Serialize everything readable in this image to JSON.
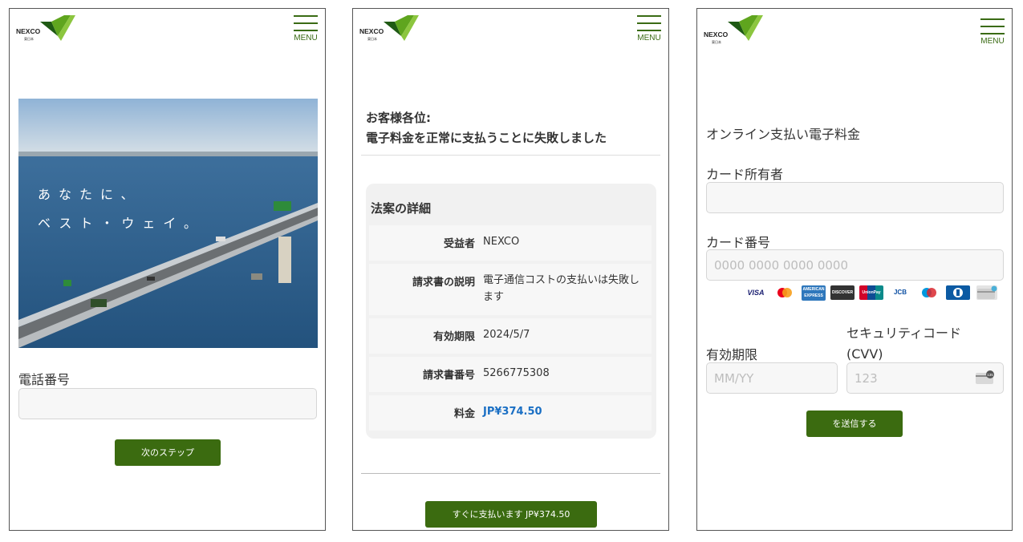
{
  "panels": [
    {
      "logo_text": "NEXCO",
      "logo_sub": "東日本",
      "menu_label": "MENU"
    },
    {
      "logo_text": "NEXCO",
      "logo_sub": "東日本",
      "menu_label": "MENU"
    },
    {
      "logo_text": "NEXCO",
      "logo_sub": "東日本",
      "menu_label": "MENU"
    }
  ],
  "hero": {
    "line1": "あなたに、",
    "line2": "ベスト・ウェイ。"
  },
  "phone_form": {
    "label": "電話番号",
    "value": "",
    "next_button": "次のステップ"
  },
  "invoice": {
    "greeting": "お客様各位:",
    "message": "電子料金を正常に支払うことに失敗しました",
    "details_title": "法案の詳細",
    "rows": [
      {
        "key": "受益者",
        "value": "NEXCO"
      },
      {
        "key": "請求書の説明",
        "value": "電子通信コストの支払いは失敗します"
      },
      {
        "key": "有効期限",
        "value": "2024/5/7"
      },
      {
        "key": "請求書番号",
        "value": "5266775308"
      },
      {
        "key": "料金",
        "value": "JP¥374.50"
      }
    ],
    "amount_color": "#1a6fc4",
    "pay_button": "すぐに支払います JP¥374.50"
  },
  "payment": {
    "title": "オンライン支払い電子料金",
    "holder_label": "カード所有者",
    "holder_value": "",
    "number_label": "カード番号",
    "number_placeholder": "0000 0000 0000 0000",
    "card_brands": [
      "VISA",
      "MasterCard",
      "AMERICAN EXPRESS",
      "DISCOVER",
      "UnionPay",
      "JCB",
      "Maestro",
      "Diners",
      "Generic"
    ],
    "expiry_label": "有効期限",
    "expiry_placeholder": "MM/YY",
    "cvv_label_1": "セキュリティコード",
    "cvv_label_2": "(CVV)",
    "cvv_placeholder": "123",
    "cvv_card_digits": "135",
    "submit_button": "を送信する"
  },
  "colors": {
    "brand_green": "#3b6b10",
    "amount_blue": "#1a6fc4"
  }
}
